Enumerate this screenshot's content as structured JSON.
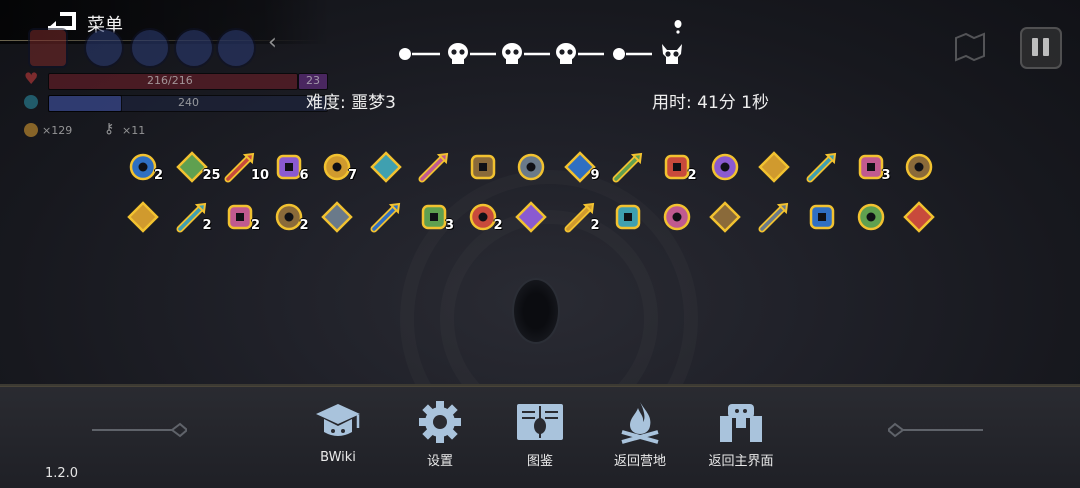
{
  "menu": {
    "title": "菜单"
  },
  "hud": {
    "hp_text": "216/216",
    "armor_badge": "23",
    "energy_text": "240",
    "coins": "×129",
    "keys": "×11"
  },
  "progress": {
    "stages": [
      "dot",
      "skull",
      "skull",
      "skull",
      "dot",
      "boss"
    ],
    "current_stage_index": 5
  },
  "run": {
    "difficulty": "难度: 噩梦3",
    "time": "用时: 41分 1秒"
  },
  "items_row1": [
    {
      "icon": "blue-octopus-helmet-icon",
      "qty": "2"
    },
    {
      "icon": "arrow-bundle-icon",
      "qty": "25"
    },
    {
      "icon": "ice-arrow-icon",
      "qty": "10"
    },
    {
      "icon": "holy-cross-arrow-icon",
      "qty": "6"
    },
    {
      "icon": "green-arrow-icon",
      "qty": "7"
    },
    {
      "icon": "rainbow-cloak-icon",
      "qty": ""
    },
    {
      "icon": "red-eye-orb-icon",
      "qty": ""
    },
    {
      "icon": "crystal-egg-icon",
      "qty": ""
    },
    {
      "icon": "golden-gauntlet-icon",
      "qty": ""
    },
    {
      "icon": "blue-gem-arrow-icon",
      "qty": "9"
    },
    {
      "icon": "dark-cloak-icon",
      "qty": ""
    },
    {
      "icon": "leaf-arrow-icon",
      "qty": "2"
    },
    {
      "icon": "target-rings-icon",
      "qty": ""
    },
    {
      "icon": "pocket-watch-icon",
      "qty": ""
    },
    {
      "icon": "vine-hammer-icon",
      "qty": ""
    },
    {
      "icon": "skeleton-icon",
      "qty": "3"
    },
    {
      "icon": "fire-arrow-icon",
      "qty": ""
    }
  ],
  "items_row2": [
    {
      "icon": "green-bird-icon",
      "qty": ""
    },
    {
      "icon": "candy-corn-icon",
      "qty": "2"
    },
    {
      "icon": "rune-crystal-icon",
      "qty": "2"
    },
    {
      "icon": "blue-glove-icon",
      "qty": "2"
    },
    {
      "icon": "pink-egg-icon",
      "qty": ""
    },
    {
      "icon": "wooden-crate-icon",
      "qty": ""
    },
    {
      "icon": "flame-feather-icon",
      "qty": "3"
    },
    {
      "icon": "fang-jaw-icon",
      "qty": "2"
    },
    {
      "icon": "purple-boot-icon",
      "qty": ""
    },
    {
      "icon": "ornate-sword-icon",
      "qty": "2"
    },
    {
      "icon": "demon-face-icon",
      "qty": ""
    },
    {
      "icon": "green-flame-icon",
      "qty": ""
    },
    {
      "icon": "jade-box-icon",
      "qty": ""
    },
    {
      "icon": "steel-claw-icon",
      "qty": ""
    },
    {
      "icon": "green-hat-icon",
      "qty": ""
    },
    {
      "icon": "golden-scroll-icon",
      "qty": ""
    },
    {
      "icon": "magnifier-icon",
      "qty": ""
    }
  ],
  "nav": [
    {
      "icon": "bwiki-graduation-cap-icon",
      "label": "BWiki"
    },
    {
      "icon": "gear-icon",
      "label": "设置"
    },
    {
      "icon": "book-icon",
      "label": "图鉴"
    },
    {
      "icon": "campfire-icon",
      "label": "返回营地"
    },
    {
      "icon": "gate-icon",
      "label": "返回主界面"
    }
  ],
  "version": "1.2.0",
  "colors": {
    "item_outline": "#f2c230",
    "bg": "#1c1d24",
    "accent_blue": "#5b8fd6"
  }
}
